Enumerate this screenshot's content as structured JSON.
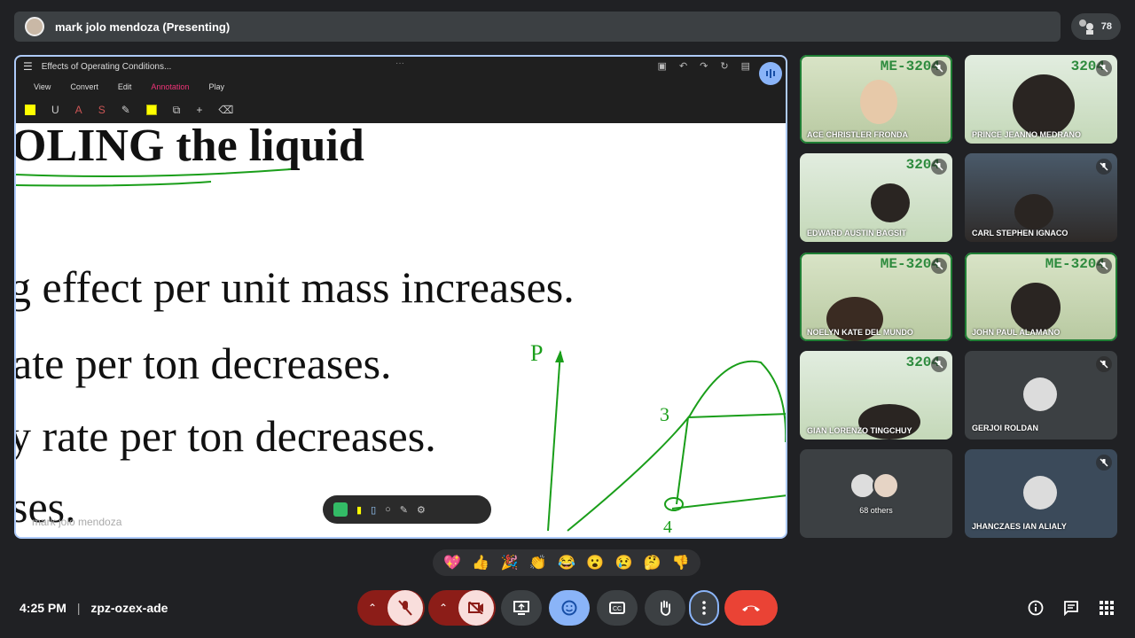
{
  "header": {
    "presenter_title": "mark jolo mendoza (Presenting)",
    "participant_count": "78"
  },
  "presentation": {
    "doc_title": "Effects of Operating Conditions...",
    "menu": [
      "View",
      "Convert",
      "Edit",
      "Annotation",
      "Play"
    ],
    "slide_lines": [
      "OLING the liquid",
      "g effect per unit mass increases.",
      "ate per ton decreases.",
      "y rate per ton decreases.",
      "ses."
    ],
    "ink_labels": {
      "p": "P",
      "n3": "3",
      "n4": "4"
    },
    "presenter_overlay": "mark jolo mendoza"
  },
  "participants": [
    {
      "name": "ACE CHRISTLER FRONDA",
      "brand": "ME-3204"
    },
    {
      "name": "PRINCE JEANNO MEDRANO",
      "brand": "3204"
    },
    {
      "name": "EDWARD AUSTIN BAGSIT",
      "brand": "3204"
    },
    {
      "name": "CARL STEPHEN IGNACO",
      "brand": ""
    },
    {
      "name": "NOELYN KATE DEL MUNDO",
      "brand": "ME-3204"
    },
    {
      "name": "JOHN PAUL ALAMANO",
      "brand": "ME-3204"
    },
    {
      "name": "GIAN LORENZO TINGCHUY",
      "brand": "3204"
    },
    {
      "name": "GERJOI ROLDAN",
      "brand": ""
    },
    {
      "name": "68 others",
      "brand": ""
    },
    {
      "name": "JHANCZAES IAN ALIALY",
      "brand": ""
    }
  ],
  "reactions": [
    "💖",
    "👍",
    "🎉",
    "👏",
    "😂",
    "😮",
    "😢",
    "🤔",
    "👎"
  ],
  "footer": {
    "time": "4:25 PM",
    "separator": "|",
    "meeting_code": "zpz-ozex-ade"
  },
  "colors": {
    "accent": "#8ab4f8",
    "end_call": "#ea4335",
    "ink": "#1a9e1a"
  }
}
